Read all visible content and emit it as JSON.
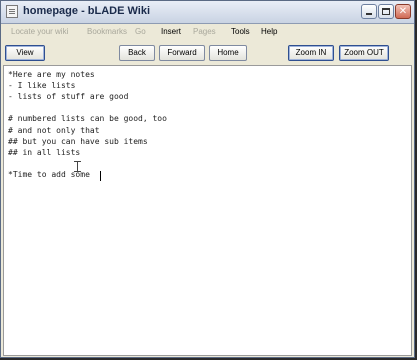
{
  "window": {
    "title": "homepage - bLADE Wiki"
  },
  "menu": {
    "items": [
      {
        "label": "Locate your wiki",
        "enabled": false
      },
      {
        "label": "Bookmarks",
        "enabled": false
      },
      {
        "label": "Go",
        "enabled": false
      },
      {
        "label": "Insert",
        "enabled": true
      },
      {
        "label": "Pages",
        "enabled": false
      },
      {
        "label": "Tools",
        "enabled": true
      },
      {
        "label": "Help",
        "enabled": true
      }
    ]
  },
  "toolbar": {
    "view_label": "View",
    "back_label": "Back",
    "forward_label": "Forward",
    "home_label": "Home",
    "zoom_in_label": "Zoom IN",
    "zoom_out_label": "Zoom OUT"
  },
  "editor": {
    "lines": [
      "*Here are my notes",
      "- I like lists",
      "- lists of stuff are good",
      "",
      "# numbered lists can be good, too",
      "# and not only that",
      "## but you can have sub items",
      "## in all lists",
      "",
      "*Time to add some"
    ]
  }
}
